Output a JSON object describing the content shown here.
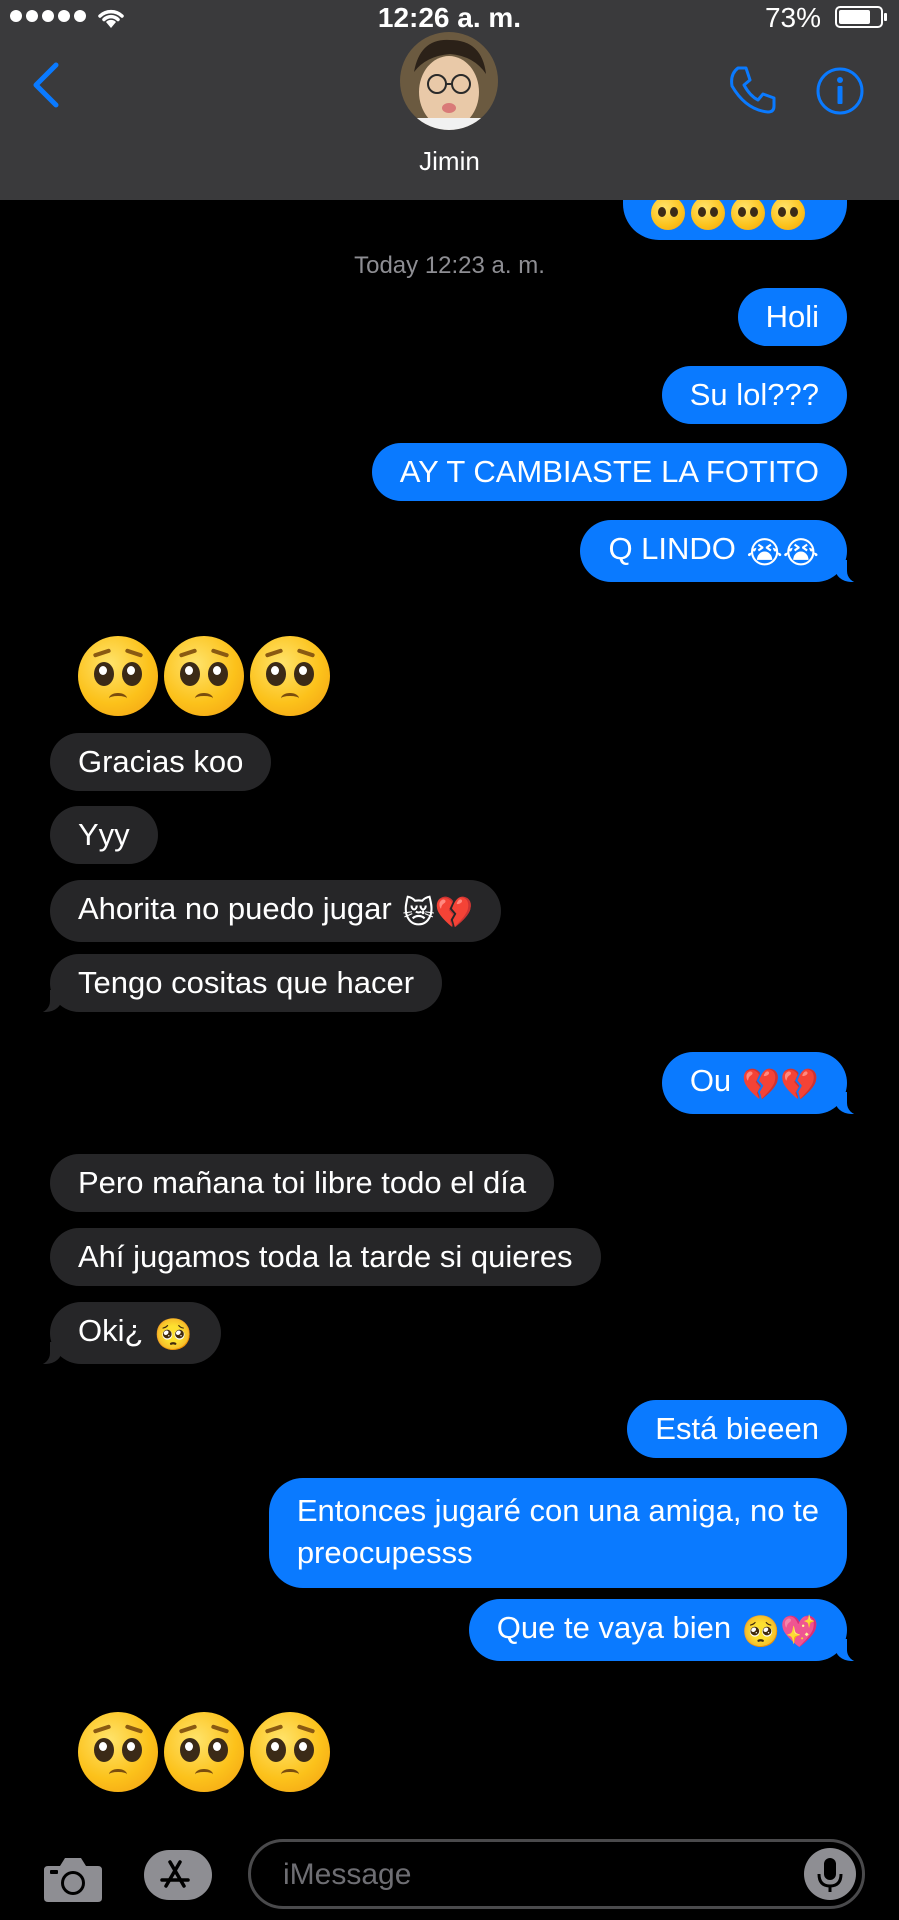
{
  "status_bar": {
    "time": "12:26 a. m.",
    "battery_percent": "73%",
    "battery_level": 0.73
  },
  "header": {
    "contact_name": "Jimin",
    "icons": [
      "chevron-left-icon",
      "phone-icon",
      "info-icon"
    ]
  },
  "thread": {
    "timestamp": "Today 12:23 a. m.",
    "messages": [
      {
        "from": "me",
        "text": "Holi"
      },
      {
        "from": "me",
        "text": "Su lol???"
      },
      {
        "from": "me",
        "text": "AY T CAMBIASTE LA FOTITO"
      },
      {
        "from": "me",
        "text": "Q LINDO",
        "emoji": "😭😭"
      },
      {
        "from": "them",
        "big_emoji": "🥺🥺🥺"
      },
      {
        "from": "them",
        "text": "Gracias koo"
      },
      {
        "from": "them",
        "text": "Yyy"
      },
      {
        "from": "them",
        "text": "Ahorita no puedo jugar",
        "emoji": "😿💔"
      },
      {
        "from": "them",
        "text": "Tengo cositas que hacer"
      },
      {
        "from": "me",
        "text": "Ou",
        "emoji": "💔💔"
      },
      {
        "from": "them",
        "text": "Pero mañana toi libre todo el día"
      },
      {
        "from": "them",
        "text": "Ahí jugamos toda la tarde si quieres"
      },
      {
        "from": "them",
        "text": "Oki¿",
        "emoji": "🥺"
      },
      {
        "from": "me",
        "text": "Está bieeen"
      },
      {
        "from": "me",
        "text_line1": "Entonces jugaré con una amiga, no te",
        "text_line2": "preocupesss"
      },
      {
        "from": "me",
        "text": "Que te vaya bien",
        "emoji": "🥺💖"
      },
      {
        "from": "them",
        "big_emoji": "🥺🥺🥺"
      }
    ]
  },
  "input_bar": {
    "placeholder": "iMessage",
    "icons": [
      "camera-icon",
      "app-store-icon",
      "microphone-icon"
    ]
  },
  "colors": {
    "sent_bubble": "#0a7aff",
    "received_bubble": "#262628",
    "accent": "#0a7aff",
    "background": "#000000"
  }
}
